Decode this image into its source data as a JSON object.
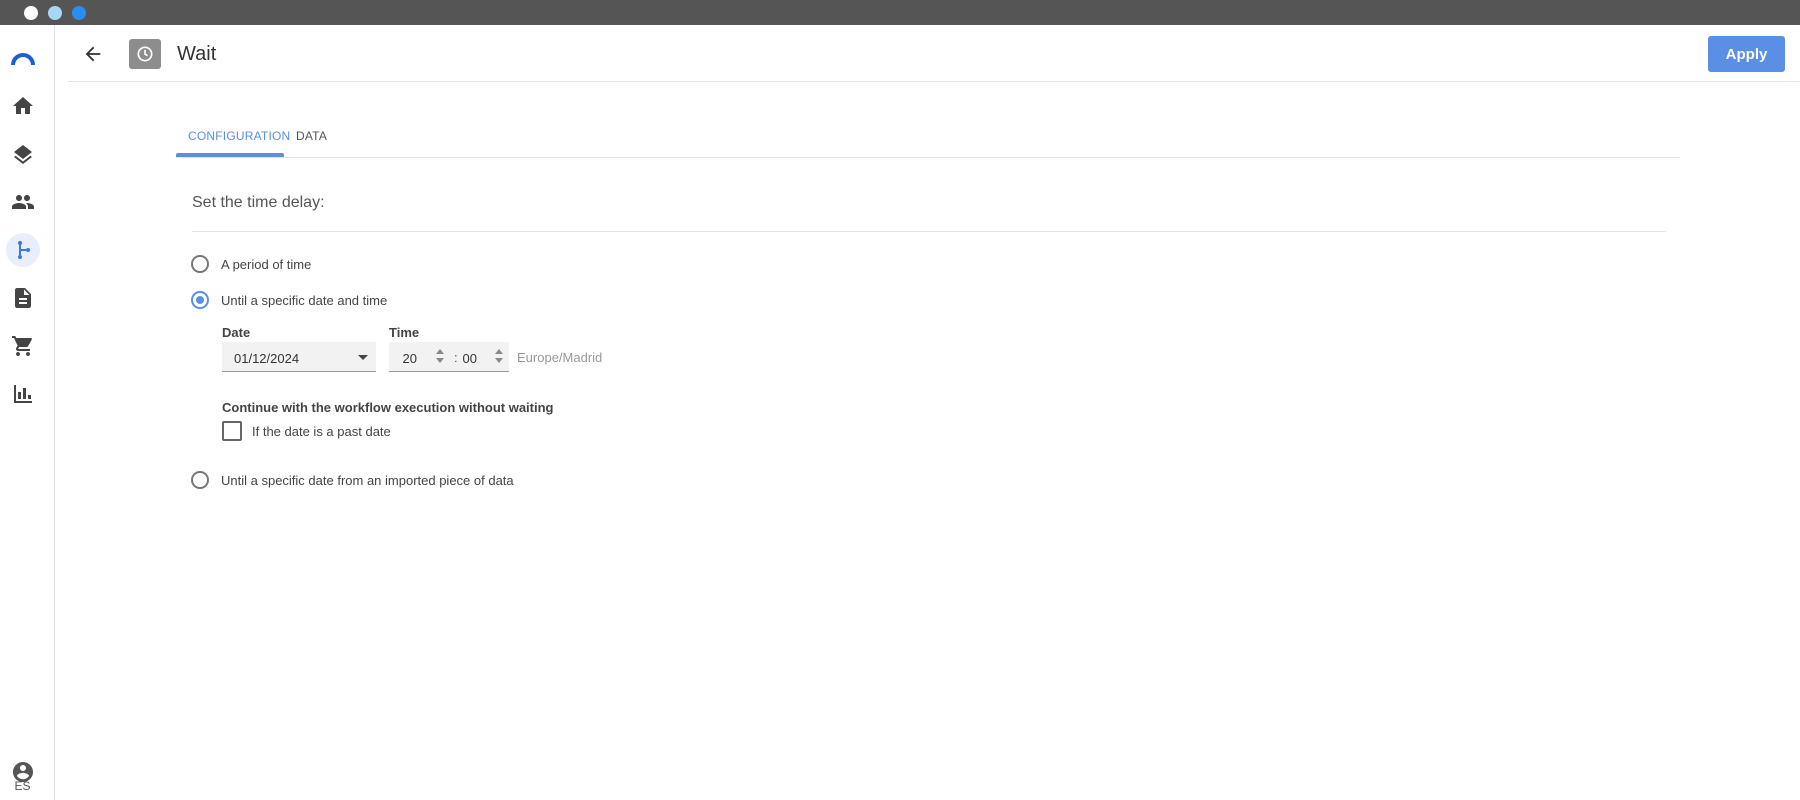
{
  "window": {
    "dots": [
      "#ffffff",
      "#a9d6f5",
      "#2a8df0"
    ]
  },
  "nav": {
    "items": [
      {
        "icon": "logo-arc-icon"
      },
      {
        "icon": "home-icon"
      },
      {
        "icon": "layers-icon"
      },
      {
        "icon": "people-icon"
      },
      {
        "icon": "workflow-branch-icon",
        "active": true
      },
      {
        "icon": "document-icon"
      },
      {
        "icon": "cart-icon"
      },
      {
        "icon": "bar-chart-icon"
      }
    ],
    "account_icon": "account-circle-icon",
    "language": "ES"
  },
  "header": {
    "back_icon": "arrow-left-icon",
    "step_icon": "clock-icon",
    "title": "Wait",
    "apply_label": "Apply"
  },
  "tabs": [
    {
      "label": "CONFIGURATION",
      "active": true
    },
    {
      "label": "DATA",
      "active": false
    }
  ],
  "config": {
    "section_label": "Set the time delay:",
    "options": [
      {
        "label": "A period of time",
        "checked": false
      },
      {
        "label": "Until a specific date and time",
        "checked": true
      },
      {
        "label": "Until a specific date from an imported piece of data",
        "checked": false
      }
    ],
    "date": {
      "label": "Date",
      "value": "01/12/2024"
    },
    "time": {
      "label": "Time",
      "hours": "20",
      "minutes": "00",
      "separator": ":",
      "timezone": "Europe/Madrid"
    },
    "continue": {
      "label": "Continue with the workflow execution without waiting",
      "checkbox_label": "If the date is a past date",
      "checked": false
    }
  },
  "colors": {
    "accent": "#5b8fe5",
    "titlebar": "#555555",
    "logo": "#1a5fd6"
  }
}
